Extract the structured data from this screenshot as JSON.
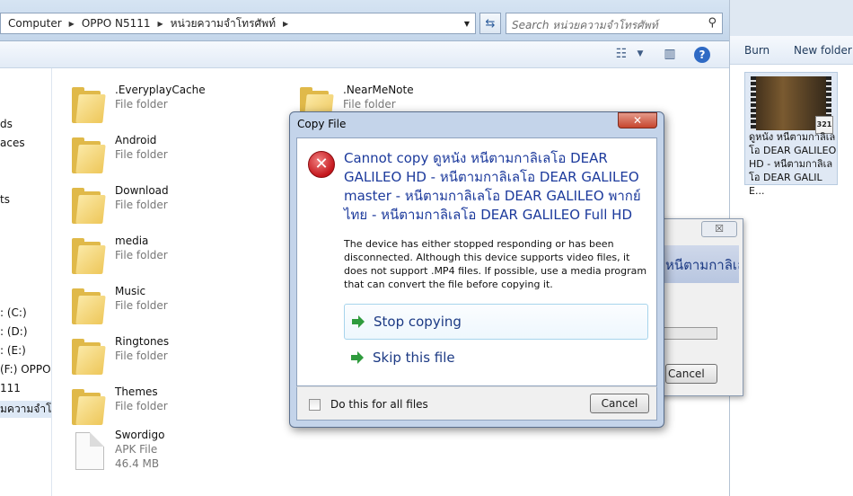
{
  "explorer": {
    "breadcrumb": [
      "Computer",
      "OPPO N5111",
      "หน่วยความจำโทรศัพท์"
    ],
    "search_placeholder": "Search หน่วยความจำโทรศัพท์",
    "nav_items": [
      "ds",
      "aces",
      "ts",
      ": (C:)",
      ": (D:)",
      ": (E:)",
      "(F:) OPPO N",
      "111",
      "มความจำโทรศัพ"
    ],
    "items": [
      {
        "name": ".EveryplayCache",
        "type": "File folder"
      },
      {
        "name": "Android",
        "type": "File folder"
      },
      {
        "name": "Download",
        "type": "File folder"
      },
      {
        "name": "media",
        "type": "File folder"
      },
      {
        "name": "Music",
        "type": "File folder"
      },
      {
        "name": "Ringtones",
        "type": "File folder"
      },
      {
        "name": "Themes",
        "type": "File folder"
      },
      {
        "name": "Swordigo",
        "type": "APK File",
        "size": "46.4 MB"
      },
      {
        "name": ".NearMeNote",
        "type": "File folder"
      }
    ]
  },
  "right_pane": {
    "burn_label": "Burn",
    "new_folder_label": "New folder",
    "video_name": "ดูหนัง หนีตามกาลิเลโอ DEAR GALILEO HD - หนีตามกาลิเลโอ DEAR GALILE...",
    "badge": "321"
  },
  "bg_dialog": {
    "close": "☒",
    "title_fragment": "หนีตามกาลิเลโอ DEAR GALILEO",
    "cancel_label": "Cancel"
  },
  "dialog": {
    "title": "Copy File",
    "close": "✕",
    "error_headline": "Cannot copy ดูหนัง หนีตามกาลิเลโอ DEAR GALILEO HD - หนีตามกาลิเลโอ DEAR GALILEO master - หนีตามกาลิเลโอ DEAR GALILEO พากย์ไทย - หนีตามกาลิเลโอ DEAR GALILEO Full HD",
    "message": "The device has either stopped responding or has been disconnected. Although this device supports video files, it does not support .MP4 files. If possible, use a media program that can convert the file before copying it.",
    "stop_copying": "Stop copying",
    "skip_file": "Skip this file",
    "checkbox_label": "Do this for all files",
    "cancel_label": "Cancel"
  }
}
